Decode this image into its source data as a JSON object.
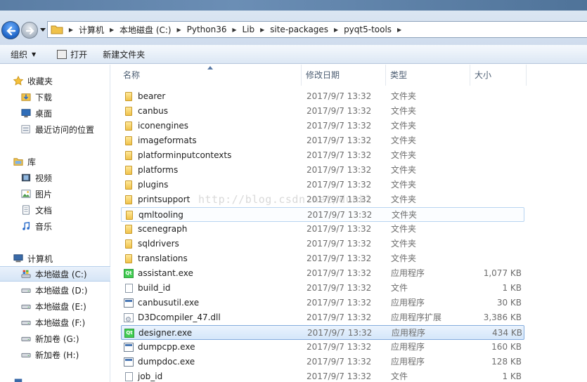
{
  "address_bar": {
    "crumbs": [
      "计算机",
      "本地磁盘 (C:)",
      "Python36",
      "Lib",
      "site-packages",
      "pyqt5-tools"
    ]
  },
  "toolbar": {
    "organize_label": "组织",
    "open_label": "打开",
    "new_folder_label": "新建文件夹"
  },
  "nav": {
    "favorites": {
      "label": "收藏夹",
      "items": [
        "下载",
        "桌面",
        "最近访问的位置"
      ]
    },
    "libraries": {
      "label": "库",
      "items": [
        "视频",
        "图片",
        "文档",
        "音乐"
      ]
    },
    "computer": {
      "label": "计算机",
      "items": [
        "本地磁盘 (C:)",
        "本地磁盘 (D:)",
        "本地磁盘 (E:)",
        "本地磁盘 (F:)",
        "新加卷 (G:)",
        "新加卷 (H:)"
      ]
    }
  },
  "columns": {
    "name": "名称",
    "date": "修改日期",
    "type": "类型",
    "size": "大小"
  },
  "files": [
    {
      "name": "bearer",
      "date": "2017/9/7 13:32",
      "type": "文件夹",
      "size": "",
      "icon": "folder-icon"
    },
    {
      "name": "canbus",
      "date": "2017/9/7 13:32",
      "type": "文件夹",
      "size": "",
      "icon": "folder-icon"
    },
    {
      "name": "iconengines",
      "date": "2017/9/7 13:32",
      "type": "文件夹",
      "size": "",
      "icon": "folder-icon"
    },
    {
      "name": "imageformats",
      "date": "2017/9/7 13:32",
      "type": "文件夹",
      "size": "",
      "icon": "folder-icon"
    },
    {
      "name": "platforminputcontexts",
      "date": "2017/9/7 13:32",
      "type": "文件夹",
      "size": "",
      "icon": "folder-icon"
    },
    {
      "name": "platforms",
      "date": "2017/9/7 13:32",
      "type": "文件夹",
      "size": "",
      "icon": "folder-icon"
    },
    {
      "name": "plugins",
      "date": "2017/9/7 13:32",
      "type": "文件夹",
      "size": "",
      "icon": "folder-icon"
    },
    {
      "name": "printsupport",
      "date": "2017/9/7 13:32",
      "type": "文件夹",
      "size": "",
      "icon": "folder-icon"
    },
    {
      "name": "qmltooling",
      "date": "2017/9/7 13:32",
      "type": "文件夹",
      "size": "",
      "icon": "folder-icon"
    },
    {
      "name": "scenegraph",
      "date": "2017/9/7 13:32",
      "type": "文件夹",
      "size": "",
      "icon": "folder-icon"
    },
    {
      "name": "sqldrivers",
      "date": "2017/9/7 13:32",
      "type": "文件夹",
      "size": "",
      "icon": "folder-icon"
    },
    {
      "name": "translations",
      "date": "2017/9/7 13:32",
      "type": "文件夹",
      "size": "",
      "icon": "folder-icon"
    },
    {
      "name": "assistant.exe",
      "date": "2017/9/7 13:32",
      "type": "应用程序",
      "size": "1,077 KB",
      "icon": "qt-exe-icon"
    },
    {
      "name": "build_id",
      "date": "2017/9/7 13:32",
      "type": "文件",
      "size": "1 KB",
      "icon": "file-icon"
    },
    {
      "name": "canbusutil.exe",
      "date": "2017/9/7 13:32",
      "type": "应用程序",
      "size": "30 KB",
      "icon": "exe-icon"
    },
    {
      "name": "D3Dcompiler_47.dll",
      "date": "2017/9/7 13:32",
      "type": "应用程序扩展",
      "size": "3,386 KB",
      "icon": "dll-icon"
    },
    {
      "name": "designer.exe",
      "date": "2017/9/7 13:32",
      "type": "应用程序",
      "size": "434 KB",
      "icon": "qt-exe-icon"
    },
    {
      "name": "dumpcpp.exe",
      "date": "2017/9/7 13:32",
      "type": "应用程序",
      "size": "160 KB",
      "icon": "exe-icon"
    },
    {
      "name": "dumpdoc.exe",
      "date": "2017/9/7 13:32",
      "type": "应用程序",
      "size": "128 KB",
      "icon": "exe-icon"
    },
    {
      "name": "job_id",
      "date": "2017/9/7 13:32",
      "type": "文件",
      "size": "1 KB",
      "icon": "file-icon"
    }
  ],
  "selected_file": "designer.exe",
  "hovered_file": "qmltooling",
  "watermark": "http://blog.csdn.net/dunkl",
  "colors": {
    "selection": "#d4e6fa",
    "selection_border": "#84acdd",
    "accent": "#1d62c4"
  }
}
